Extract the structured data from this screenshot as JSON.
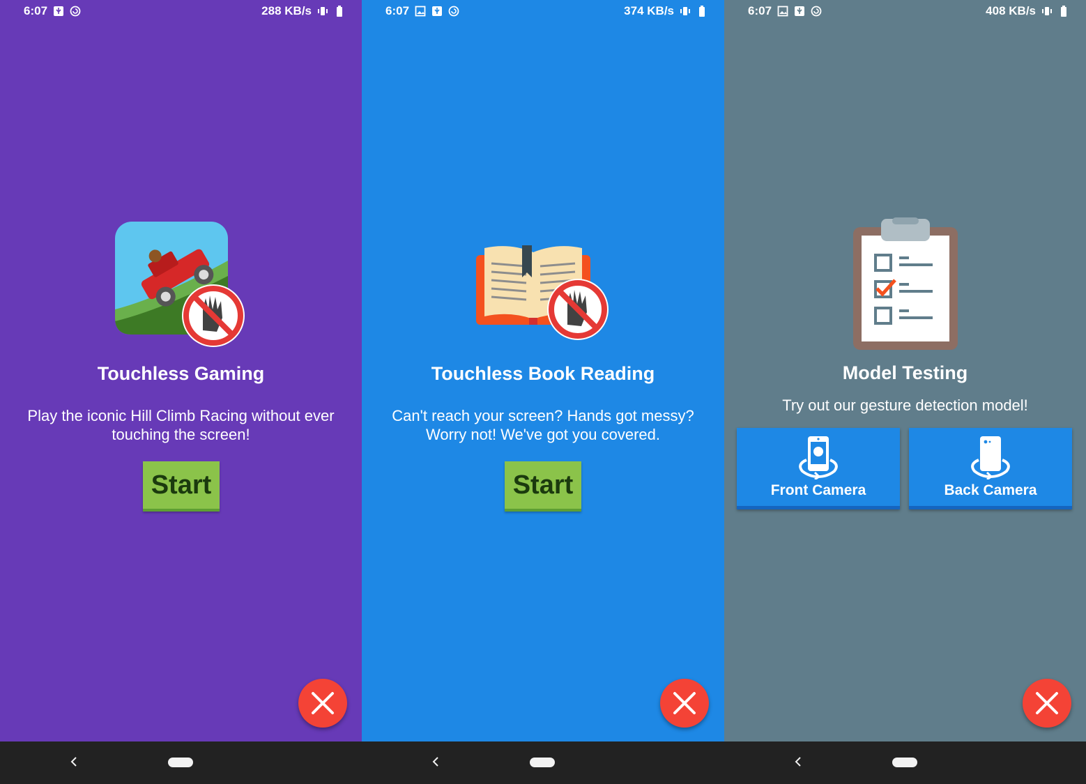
{
  "colors": {
    "gaming_bg": "#673ab7",
    "reading_bg": "#1e88e5",
    "testing_bg": "#607d8b",
    "start_button": "#8bc34a",
    "close_button": "#f44336",
    "nav_bar": "#222222"
  },
  "screens": [
    {
      "status": {
        "time": "6:07",
        "speed": "288 KB/s",
        "icons": [
          "usb-icon",
          "sync-icon",
          "vibrate-icon",
          "battery-icon"
        ]
      },
      "icon": "hill-climb-no-touch-icon",
      "title": "Touchless Gaming",
      "description_line1": "Play the iconic Hill Climb Racing without ever",
      "description_line2": "touching the screen!",
      "start_label": "Start",
      "close_icon": "close-icon"
    },
    {
      "status": {
        "time": "6:07",
        "speed": "374 KB/s",
        "icons": [
          "image-icon",
          "usb-icon",
          "sync-icon",
          "vibrate-icon",
          "battery-icon"
        ]
      },
      "icon": "book-no-touch-icon",
      "title": "Touchless Book Reading",
      "description_line1": "Can't reach your screen? Hands got messy?",
      "description_line2": "Worry not! We've got you covered.",
      "start_label": "Start",
      "close_icon": "close-icon"
    },
    {
      "status": {
        "time": "6:07",
        "speed": "408 KB/s",
        "icons": [
          "image-icon",
          "usb-icon",
          "sync-icon",
          "vibrate-icon",
          "battery-icon"
        ]
      },
      "icon": "clipboard-checklist-icon",
      "title": "Model Testing",
      "description": "Try out our gesture detection model!",
      "front_camera_label": "Front Camera",
      "back_camera_label": "Back Camera",
      "close_icon": "close-icon"
    }
  ],
  "nav": {
    "back_icon": "back-chevron-icon",
    "home_icon": "home-pill-icon"
  }
}
